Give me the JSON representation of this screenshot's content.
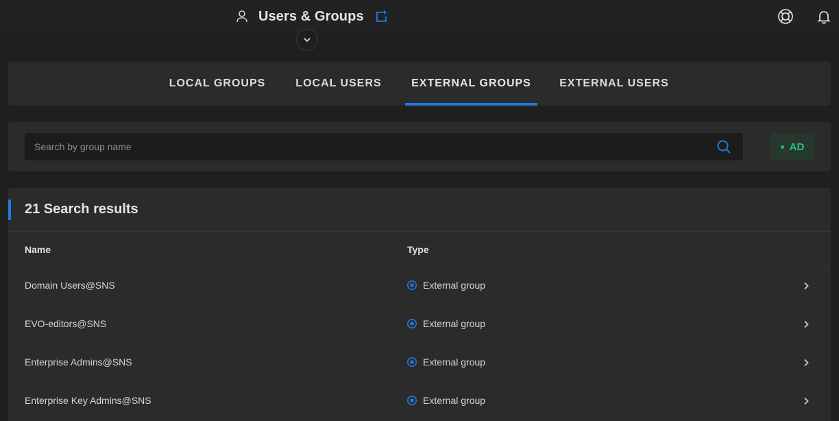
{
  "header": {
    "title": "Users & Groups",
    "icons": {
      "user": "user-icon",
      "pin": "pin-icon",
      "expand": "chevron-down-icon",
      "help": "lifebuoy-icon",
      "notifications": "bell-icon"
    }
  },
  "tabs": [
    {
      "label": "LOCAL GROUPS",
      "active": false
    },
    {
      "label": "LOCAL USERS",
      "active": false
    },
    {
      "label": "EXTERNAL GROUPS",
      "active": true
    },
    {
      "label": "EXTERNAL USERS",
      "active": false
    }
  ],
  "search": {
    "placeholder": "Search by group name",
    "value": "",
    "filter_chip": {
      "label": "AD",
      "color": "#33c17a"
    }
  },
  "results": {
    "title": "21 Search results",
    "columns": {
      "name": "Name",
      "type": "Type"
    },
    "rows": [
      {
        "name": "Domain Users@SNS",
        "type": "External group"
      },
      {
        "name": "EVO-editors@SNS",
        "type": "External group"
      },
      {
        "name": "Enterprise Admins@SNS",
        "type": "External group"
      },
      {
        "name": "Enterprise Key Admins@SNS",
        "type": "External group"
      }
    ]
  },
  "colors": {
    "accent": "#1e7ae0",
    "background": "#1f1f1f",
    "card": "#2b2b2b"
  }
}
